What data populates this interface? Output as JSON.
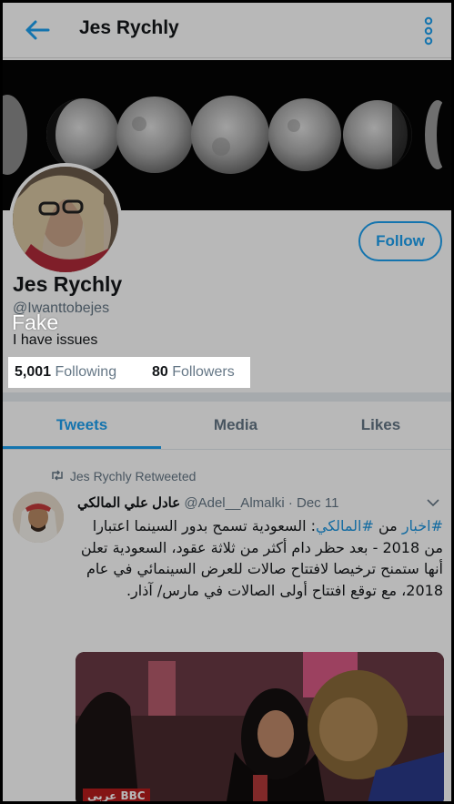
{
  "header": {
    "title": "Jes Rychly",
    "back_icon": "arrow-left-icon",
    "more_icon": "more-vertical-icon",
    "accent": "#1da1f2"
  },
  "profile": {
    "name": "Jes Rychly",
    "handle": "@Iwanttobejes",
    "bio": "I have issues",
    "follow_label": "Follow",
    "annotation": "Fake",
    "following_count": "5,001",
    "following_label": "Following",
    "followers_count": "80",
    "followers_label": "Followers"
  },
  "tabs": [
    {
      "label": "Tweets",
      "active": true
    },
    {
      "label": "Media",
      "active": false
    },
    {
      "label": "Likes",
      "active": false
    }
  ],
  "tweet": {
    "retweeted_by": "Jes Rychly Retweeted",
    "author_name": "عادل علي المالكي",
    "author_handle": "@Adel__Almalki",
    "date": "Dec 11",
    "text_hash1": "#اخبار",
    "text_from": "من",
    "text_hash2": "#المالكي",
    "text_body": ": السعودية تسمح بدور السينما اعتبارا من 2018 - بعد حظر دام أكثر من ثلاثة عقود، السعودية تعلن أنها ستمنح ترخيصا لافتتاح صالات للعرض السينمائي في عام 2018، مع توقع افتتاح أولى الصالات في مارس/ آذار.",
    "media_caption": "عربي BBC"
  }
}
